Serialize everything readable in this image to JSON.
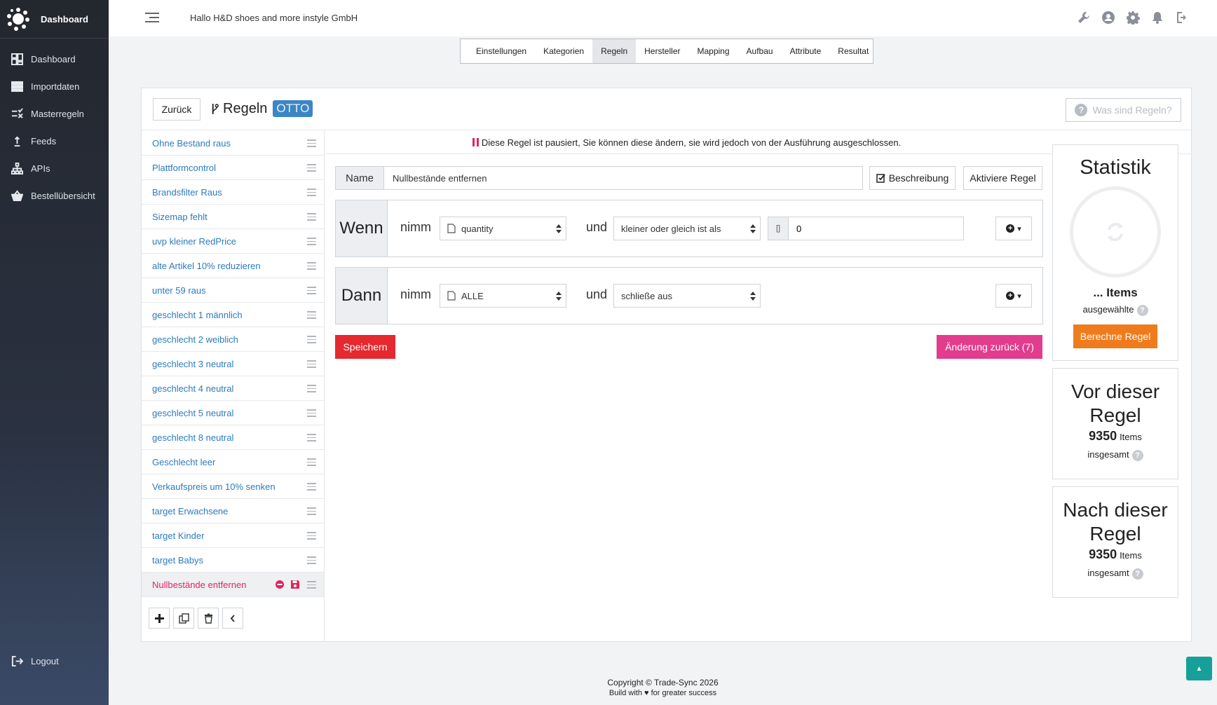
{
  "sidebar": {
    "brand": "Dashboard",
    "items": [
      {
        "label": "Dashboard",
        "icon": "dashboard-icon"
      },
      {
        "label": "Importdaten",
        "icon": "database-icon"
      },
      {
        "label": "Masterregeln",
        "icon": "rules-icon"
      },
      {
        "label": "Feeds",
        "icon": "upload-icon"
      },
      {
        "label": "APIs",
        "icon": "sitemap-icon"
      },
      {
        "label": "Bestellübersicht",
        "icon": "basket-icon"
      }
    ],
    "logout": "Logout"
  },
  "header": {
    "greeting": "Hallo H&D shoes and more instyle GmbH"
  },
  "steps": [
    "Einstellungen",
    "Kategorien",
    "Regeln",
    "Hersteller",
    "Mapping",
    "Aufbau",
    "Attribute",
    "Resultat"
  ],
  "active_step": "Regeln",
  "panel": {
    "back_label": "Zurück",
    "title": "Regeln",
    "badge": "OTTO",
    "help_label": "Was sind Regeln?"
  },
  "rules": [
    "Ohne Bestand raus",
    "Plattformcontrol",
    "Brandsfilter Raus",
    "Sizemap fehlt",
    "uvp kleiner RedPrice",
    "alte Artikel 10% reduzieren",
    "unter 59 raus",
    "geschlecht 1 männlich",
    "geschlecht 2 weiblich",
    "geschlecht 3 neutral",
    "geschlecht 4 neutral",
    "geschlecht 5 neutral",
    "geschlecht 8 neutral",
    "Geschlecht leer",
    "Verkaufspreis um 10% senken",
    "target Erwachsene",
    "target Kinder",
    "target Babys"
  ],
  "active_rule": "Nullbestände entfernen",
  "editor": {
    "notice": "Diese Regel ist pausiert, Sie können diese ändern, sie wird jedoch von der Ausführung ausgeschlossen.",
    "name_label": "Name",
    "name_value": "Nullbestände entfernen",
    "desc_label": "Beschreibung",
    "activate_label": "Aktiviere Regel",
    "if": {
      "label": "Wenn",
      "take": "nimm",
      "field": "quantity",
      "and": "und",
      "operator": "kleiner oder gleich ist als",
      "prefix": "[]",
      "value": "0"
    },
    "then": {
      "label": "Dann",
      "take": "nimm",
      "field": "ALLE",
      "and": "und",
      "action": "schließe aus"
    },
    "save_label": "Speichern",
    "undo_label": "Änderung zurück (7)"
  },
  "stats": {
    "title": "Statistik",
    "items_label": "... Items",
    "selected_label": "ausgewählte",
    "calc_label": "Berechne Regel",
    "before_title_1": "Vor dieser",
    "before_title_2": "Regel",
    "before_count": "9350",
    "after_title_1": "Nach dieser",
    "after_title_2": "Regel",
    "after_count": "9350",
    "items_word": "Items",
    "total_label": "insgesamt",
    "help_mark": "?"
  },
  "footer": {
    "copyright": "Copyright © Trade-Sync 2026",
    "build_pre": "Build with",
    "build_post": "for greater success"
  },
  "colors": {
    "accent_blue": "#2b7bbf",
    "danger": "#e5292f",
    "pink": "#e23c8e",
    "orange": "#f07b1d",
    "teal": "#17a09a"
  }
}
